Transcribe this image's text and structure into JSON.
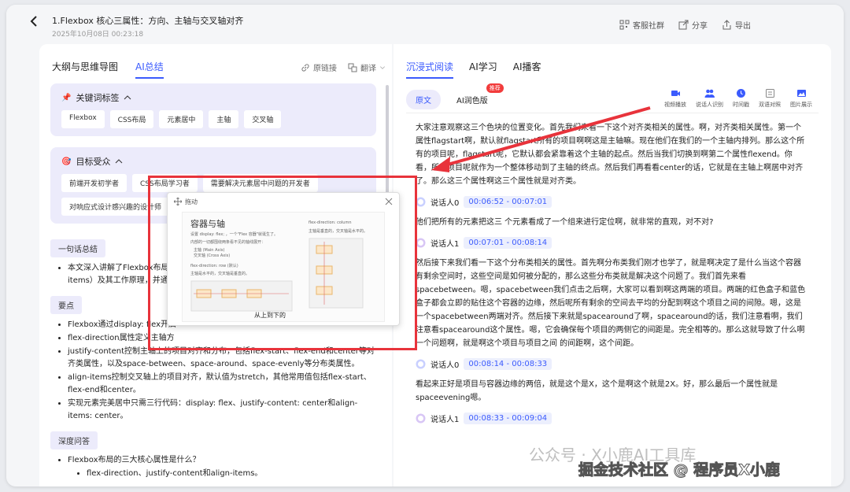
{
  "header": {
    "title": "1.Flexbox 核心三属性：方向、主轴与交叉轴对齐",
    "date": "2025年10月08日 00:23:18",
    "actions": [
      {
        "label": "客服社群",
        "icon": "qrcode-icon"
      },
      {
        "label": "分享",
        "icon": "share-icon"
      },
      {
        "label": "导出",
        "icon": "export-icon"
      }
    ]
  },
  "left": {
    "tabs": [
      {
        "label": "大纲与思维导图",
        "active": false
      },
      {
        "label": "AI总结",
        "active": true
      }
    ],
    "tools": [
      {
        "label": "原链接",
        "icon": "link-icon"
      },
      {
        "label": "翻译",
        "icon": "translate-icon"
      }
    ],
    "keywords": {
      "title": "关键词标签",
      "tags": [
        "Flexbox",
        "CSS布局",
        "元素居中",
        "主轴",
        "交叉轴"
      ]
    },
    "audience": {
      "title": "目标受众",
      "tags": [
        "前端开发初学者",
        "CSS布局学习者",
        "需要解决元素居中问题的开发者",
        "对响应式设计感兴趣的设计师"
      ]
    },
    "summary": {
      "label": "一句话总结",
      "text": "本文深入讲解了Flexbox布局的核心概念（容器与项目、主轴与交叉轴）及其工作原理，并通过具体属性演示实现元素居中等常见布局。",
      "visible_line1": "本文深入讲解了Flexbox布局的",
      "visible_line2": "items）及其工作原理，并通过"
    },
    "key_points": {
      "label": "要点",
      "items": [
        "Flexbox通过display: flex开启",
        "flex-direction属性定义主轴方",
        "justify-content控制主轴上的项目对齐和分布，包括flex-start、flex-end和center等对齐类属性，以及space-between、space-around、space-evenly等分布类属性。",
        "align-items控制交叉轴上的项目对齐，默认值为stretch，其他常用值包括flex-start、flex-end和center。",
        "实现元素完美居中只需三行代码：display: flex、justify-content: center和align-items: center。"
      ]
    },
    "qa": {
      "label": "深度问答",
      "question": "Flexbox布局的三大核心属性是什么？",
      "answer": "flex-direction、justify-content和align-items。"
    }
  },
  "right": {
    "tabs": [
      {
        "label": "沉浸式阅读",
        "active": true
      },
      {
        "label": "AI学习",
        "active": false
      },
      {
        "label": "AI播客",
        "active": false
      }
    ],
    "modes": [
      {
        "label": "原文",
        "active": true,
        "badge": ""
      },
      {
        "label": "AI润色版",
        "active": false,
        "badge": "推荐"
      }
    ],
    "tools": [
      {
        "label": "视频播放",
        "icon": "video-icon"
      },
      {
        "label": "说话人识别",
        "icon": "speakers-icon"
      },
      {
        "label": "时间戳",
        "icon": "clock-icon"
      },
      {
        "label": "双语对照",
        "icon": "bilingual-icon"
      },
      {
        "label": "图片展示",
        "icon": "image-icon"
      }
    ],
    "transcript": [
      {
        "type": "para",
        "text": "大家注意观察这三个色块的位置变化。首先我们来看一下这个对齐类相关的属性。啊，对齐类相关属性。第一个属性flagstart啊，默认就flagstart所有的项目啊啊这是主轴嘛。现在他们在我们的一个主轴内排列。那么这个所有的项目呢，flagstart呢，它默认都会紧靠着这个主轴的起点。然后当我们切换到啊第二个属性flexend。你看，所有项目呢就作为一个整体移动到了主轴的终点。然后我们再看看center的话，它就是在主轴上啊居中对齐了。那么这三个属性啊这三个属性就是对齐类。"
      },
      {
        "type": "speaker",
        "name": "说话人0",
        "time": "00:06:52 - 00:07:01"
      },
      {
        "type": "para",
        "text": "他们把所有的元素把这三 个元素看成了一个组来进行定位啊，就非常的直观，对不对?"
      },
      {
        "type": "speaker",
        "name": "说话人1",
        "time": "00:07:01 - 00:08:14"
      },
      {
        "type": "para",
        "text": "然后接下来我们看一下这个分布类相关的属性。首先啊分布类我们刚才也学了，就是啊决定了是什么当这个容器有剩余空间时，这些空间是如何被分配的，那么这些分布类就是解决这个问题了。我们首先来看spacebetween。嗯，spacebetween我们点击之后啊，大家可以看到啊这两端的项目。两端的红色盒子和蓝色盒子都会立即的贴住这个容器的边缘，然后呢所有剩余的空间去平均的分配到啊这个项目之间的间隙。嗯，这是一个spacebetween两端对齐。然后接下来就是spacearound了啊，spacearound的话，我们注意看啊，我们注意看spacearound这个属性。嗯，它会确保每个项目的两侧它的间距是。完全相等的。那么这就导致了什么啊一个问题啊，就是啊这个项目与项目之间 的间距啊，这个间距。"
      },
      {
        "type": "speaker",
        "name": "说话人0",
        "time": "00:08:14 - 00:08:33"
      },
      {
        "type": "para",
        "text": "看起来正好是项目与容器边缘的两倍，就是这个是X，这个是啊这个就是2X。好，那么最后一个属性就是 spaceevening嗯。"
      },
      {
        "type": "speaker",
        "name": "说话人1",
        "time": "00:08:33 - 00:09:04"
      }
    ]
  },
  "popup": {
    "drag_label": "拖动",
    "slide_title": "容器与轴",
    "slide_sub": "设置 display: flex; ，一个\"Flex 容器\"就诞生了。",
    "slide_hint": "内部的一切都围绕两条看不见的轴线展开：",
    "axis_main": "主轴 (Main Axis)",
    "axis_cross": "交叉轴 (Cross Axis)",
    "row_label": "flex-direction: row (默认)",
    "row_desc": "主轴是水平的，交叉轴是垂直的。",
    "col_label": "flex-direction: column",
    "col_desc": "主轴是垂直的，交叉轴是水平的。",
    "caption": "从上到下的"
  },
  "watermark": {
    "line1": "公众号 · X小鹿AI工具库",
    "line2": "掘金技术社区 @ 程序员X小鹿"
  },
  "colors": {
    "accent": "#3b5bfd",
    "panel_tint": "#ecebfb",
    "highlight_red": "#e8333b"
  }
}
